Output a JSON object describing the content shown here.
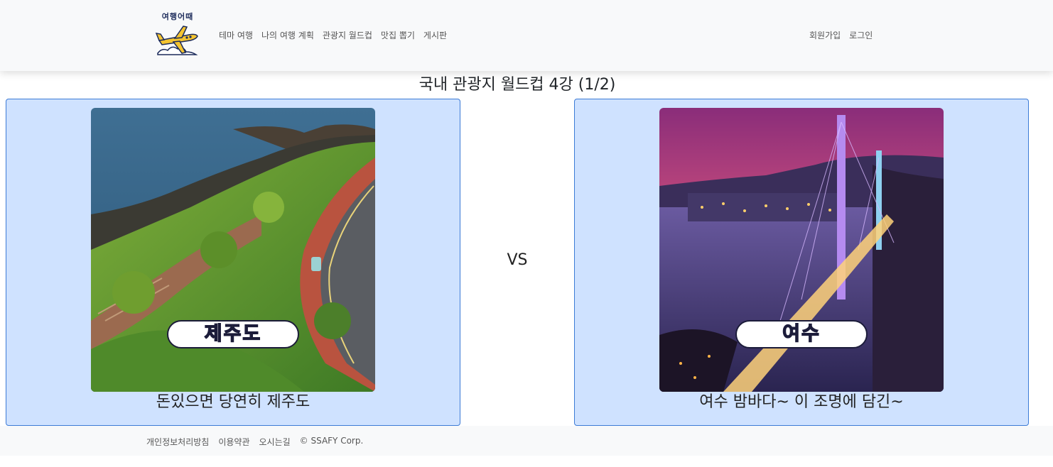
{
  "header": {
    "logo_text": "여행어때",
    "nav_left": [
      "테마 여행",
      "나의 여행 계획",
      "관광지 월드컵",
      "맛집 뽑기",
      "게시판"
    ],
    "nav_right": [
      "회원가입",
      "로그인"
    ],
    "bg_color": "#f8f9fa"
  },
  "page": {
    "title": "국내 관광지 월드컵 4강 (1/2)",
    "vs_label": "VS"
  },
  "candidates": [
    {
      "badge": "제주도",
      "description": "돈있으면 당연히 제주도",
      "image_icon": "jeju-coastal-road-photo"
    },
    {
      "badge": "여수",
      "description": "여수 밤바다~ 이 조명에 담긴~",
      "image_icon": "yeosu-night-bridge-photo"
    }
  ],
  "card_colors": {
    "background": "#cfe2ff",
    "border": "#3d7bd6"
  },
  "footer": {
    "links": [
      "개인정보처리방침",
      "이용약관",
      "오시는길"
    ],
    "copyright": "© SSAFY Corp."
  }
}
